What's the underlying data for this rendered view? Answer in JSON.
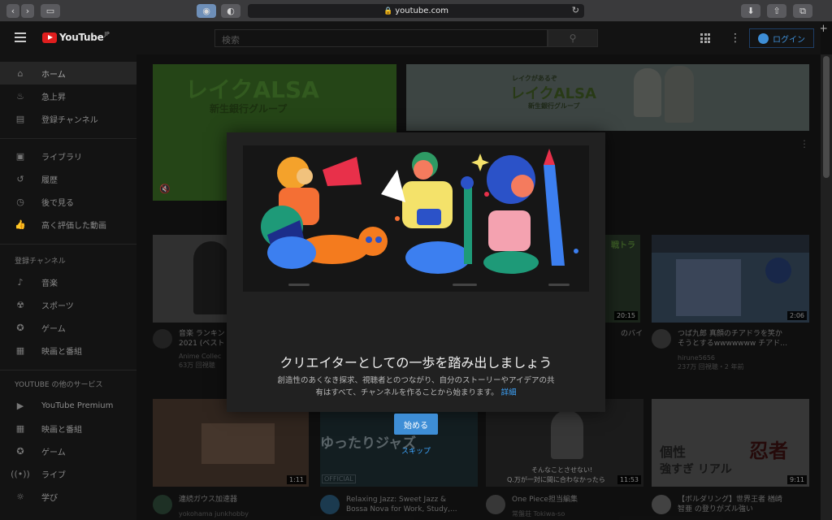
{
  "browser": {
    "url": "youtube.com",
    "new_tab": "+"
  },
  "header": {
    "logo_text": "YouTube",
    "logo_region": "JP",
    "search_placeholder": "検索",
    "login_label": "ログイン"
  },
  "sidebar": {
    "main_items": [
      {
        "label": "ホーム",
        "icon": "home-icon"
      },
      {
        "label": "急上昇",
        "icon": "fire-icon"
      },
      {
        "label": "登録チャンネル",
        "icon": "subscriptions-icon"
      }
    ],
    "library_items": [
      {
        "label": "ライブラリ",
        "icon": "library-icon"
      },
      {
        "label": "履歴",
        "icon": "history-icon"
      },
      {
        "label": "後で見る",
        "icon": "clock-icon"
      },
      {
        "label": "高く評価した動画",
        "icon": "thumbs-up-icon"
      }
    ],
    "subs_heading": "登録チャンネル",
    "subs_items": [
      {
        "label": "音楽",
        "icon": "music-icon"
      },
      {
        "label": "スポーツ",
        "icon": "trophy-icon"
      },
      {
        "label": "ゲーム",
        "icon": "gamepad-icon"
      },
      {
        "label": "映画と番組",
        "icon": "film-icon"
      }
    ],
    "more_heading": "YOUTUBE の他のサービス",
    "more_items": [
      {
        "label": "YouTube Premium",
        "icon": "youtube-icon"
      },
      {
        "label": "映画と番組",
        "icon": "film-icon"
      },
      {
        "label": "ゲーム",
        "icon": "gamepad-icon"
      },
      {
        "label": "ライブ",
        "icon": "live-icon"
      },
      {
        "label": "学び",
        "icon": "bulb-icon"
      }
    ]
  },
  "ads": {
    "left_title": "レイクALSA",
    "left_sub": "新生銀行グループ",
    "right_top": "レイクがあるぞ",
    "right_title": "レイクALSA",
    "right_sub": "新生銀行グループ"
  },
  "videos": [
    {
      "title_line1": "音楽 ランキン",
      "title_line2": "2021 (ベスト",
      "channel": "Anime Collec",
      "meta": "63万 回視聴"
    },
    {
      "overlay": "戦トラ",
      "title_line1": "のバイ",
      "title_line2": "",
      "channel": "",
      "meta": "",
      "duration": "20:15"
    },
    {
      "title_line1": "つば九郎 真顔のチアドラを笑か",
      "title_line2": "そうとするwwwwwww チアド…",
      "channel": "hirune5656",
      "meta": "237万 回視聴・2 年前",
      "duration": "2:06"
    },
    {
      "title_line1": "連続ガウス加速器",
      "title_line2": "",
      "channel": "yokohama junkhobby",
      "meta": "",
      "duration": "1:11"
    },
    {
      "overlay": "ゆったりジャズ",
      "overlay_badge": "OFFICIAL",
      "title_line1": "Relaxing Jazz: Sweet Jazz &",
      "title_line2": "Bossa Nova for Work, Study,...",
      "channel": "",
      "meta": ""
    },
    {
      "overlay_top": "そんなことさせない!",
      "overlay_bottom": "Q.万が一対に間に合わなかったら",
      "title_line1": "One Piece担当編集",
      "title_line2": "",
      "channel": "常盤荘 Tokiwa-so",
      "meta": "",
      "duration": "11:53"
    },
    {
      "overlay_left": "個性",
      "overlay_left2": "強すぎ リアル",
      "overlay_right": "忍者",
      "title_line1": "【ボルダリング】世界王者 楢崎",
      "title_line2": "智亜 の登りがズル強い",
      "channel": "",
      "meta": "",
      "duration": "9:11"
    }
  ],
  "modal": {
    "title": "クリエイターとしての一歩を踏み出しましょう",
    "desc_line1": "創造性のあくなき探求、視聴者とのつながり、自分のストーリーやアイデアの共",
    "desc_line2": "有はすべて、チャンネルを作ることから始まります。",
    "details_link": "詳細",
    "start_button": "始める",
    "skip_link": "スキップ"
  },
  "colors": {
    "accent": "#3ea6ff",
    "brand_red": "#e01e1e",
    "button_blue": "#3e8ed6"
  }
}
